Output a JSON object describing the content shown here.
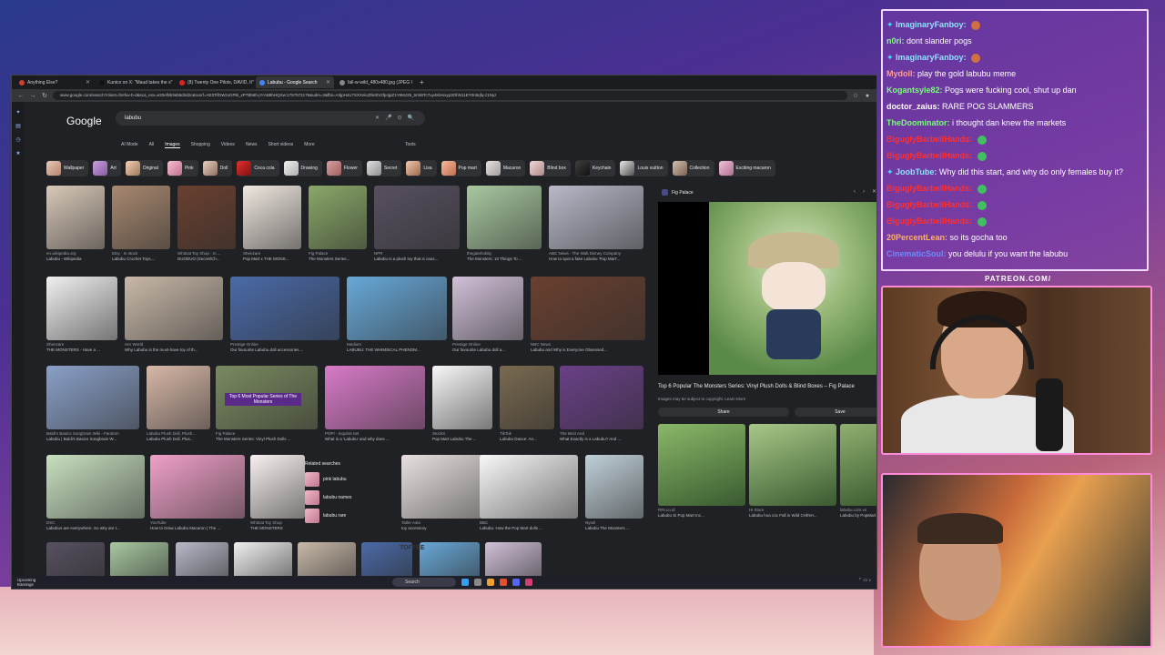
{
  "browser": {
    "tabs": [
      {
        "label": "Anything Else?",
        "color": "#d04030",
        "active": false
      },
      {
        "label": "Kunico on X: \"Maud takes the s\"",
        "color": "#111111",
        "active": false
      },
      {
        "label": "(8) Twenty One Pilots, DAVID, It\"",
        "color": "#e02020",
        "active": false
      },
      {
        "label": "Labubu - Google Search",
        "color": "#4285f4",
        "active": true
      },
      {
        "label": "fall-w-wild_480x480.jpg (JPEG I",
        "color": "#888888",
        "active": false
      }
    ],
    "url": "www.google.com/search?client=firefox-b-d&sca_esv=e20ef5b3eb6d2d2c&sxsrf=AE3TifOWzxGPl6_xP7Bb6h-jYrAB8hHQXw:1757572176&udm=2&fbs=AIIjpHxU7SXXniUZfeShr2fp4giZ1Y6MJ25_tmWITc7uy4Klesxyp3OhN11EY0n5qfq-z1Nyz",
    "search_query": "labubu",
    "filters": [
      "AI Mode",
      "All",
      "Images",
      "Shopping",
      "Videos",
      "News",
      "Short videos",
      "More"
    ],
    "active_filter": "Images",
    "tools_label": "Tools",
    "chips": [
      "Wallpaper",
      "Art",
      "Original",
      "Pink",
      "Doll",
      "Coca cola",
      "Drawing",
      "Flower",
      "Secret",
      "Lisa",
      "Pop mart",
      "Macaron",
      "Blind box",
      "Keychain",
      "Louis vuitton",
      "Collection",
      "Exciting macaron"
    ],
    "results": [
      {
        "source": "en.wikipedia.org",
        "title": "Labubu - Wikipedia"
      },
      {
        "source": "Etsy · In stock",
        "title": "Labubu Crochet Toys,..."
      },
      {
        "source": "Whitcat Toy Shop · In ...",
        "title": "DUODUO (Secret/Ch..."
      },
      {
        "source": "Shenzare",
        "title": "Pop Mart x THE MONS..."
      },
      {
        "source": "Fig Palace",
        "title": "The Monsters Series..."
      },
      {
        "source": "NPR",
        "title": "Labubu is a plush toy that is caus..."
      },
      {
        "source": "thegatehobby",
        "title": "The Monsters: 10 Things To ..."
      },
      {
        "source": "ABC News - The Walt Disney Company",
        "title": "How to spot a fake Labubu 'Pop Mart'..."
      },
      {
        "source": "Shenzare",
        "title": "THE MONSTERS - Have a ..."
      },
      {
        "source": "Her World",
        "title": "Why Labubu is the must-have toy of th..."
      },
      {
        "source": "Prestige Online",
        "title": "Our favourite Labubu doll accessories ..."
      },
      {
        "source": "Medium",
        "title": "LABUBU: THE WHIMSICAL PHENOM..."
      },
      {
        "source": "Prestige Online",
        "title": "Our favourite Labubu doll a..."
      },
      {
        "source": "NBC News",
        "title": "Labubu and Why is Everyone Obsessed..."
      },
      {
        "source": "Baldi's Basics Songbrain Wiki - Fandom",
        "title": "Labubu | Baldi's Basics Songbrain W..."
      },
      {
        "source": "Labubu Plush Doll, Plush...",
        "title": "Labubu Plush Doll, Plus..."
      },
      {
        "source": "Fig Palace",
        "title": "The Monsters Series: Vinyl Plush Dolls ..."
      },
      {
        "source": "POP! - Inquirer.net",
        "title": "What is a 'Labubu' and why does ..."
      },
      {
        "source": "StockX",
        "title": "Pop Mart Labubu The ..."
      },
      {
        "source": "TikTok",
        "title": "Labubu Dance: An..."
      },
      {
        "source": "The Best And",
        "title": "What Exactly is a Labubu? And ..."
      },
      {
        "source": "DSC",
        "title": "Labubus are everywhere. So why are t..."
      },
      {
        "source": "YouTube",
        "title": "How to Draw Labubu Macaron | The ..."
      },
      {
        "source": "Whitcat Toy Shop",
        "title": "THE MONSTERS"
      },
      {
        "source": "Tatler Asia",
        "title": "toy accessory"
      },
      {
        "source": "BBC",
        "title": "Labubu: How the Pop Mart dolls ..."
      },
      {
        "source": "Nysel",
        "title": "Labubu The Monsters ..."
      }
    ],
    "overlay_text": "Top 6 Most Popular Series of The Monsters",
    "toffee_label": "TOFFEE",
    "related": {
      "heading": "Related searches",
      "items": [
        "pink labubu",
        "labubu names",
        "labubu rare"
      ]
    },
    "preview": {
      "site": "Fig Palace",
      "title": "Top 6 Popular The Monsters Series: Vinyl Plush Dolls & Blind Boxes – Fig Palace",
      "subtitle": "Images may be subject to copyright. Learn More",
      "share_label": "Share",
      "save_label": "Save",
      "more": [
        {
          "source": "RRI.co.id",
          "title": "Labubu Si Pop Mart Inc..."
        },
        {
          "source": "Hi Store",
          "title": "Labubu hoa cúc Fall in Wild CHÍNH..."
        },
        {
          "source": "labubu.com.vn",
          "title": "Labubu by PopMart tu..."
        }
      ]
    },
    "taskbar": {
      "left_line1": "Upcoming",
      "left_line2": "Earnings",
      "search": "Search"
    }
  },
  "chat": {
    "messages": [
      {
        "user": "ImaginaryFanboy:",
        "text": "",
        "color": "#8fe3ff",
        "badge": true,
        "emote": true
      },
      {
        "user": "n0ri:",
        "text": "dont slander pogs",
        "color": "#80ff80",
        "badge": false,
        "emote": false
      },
      {
        "user": "ImaginaryFanboy:",
        "text": "",
        "color": "#8fe3ff",
        "badge": true,
        "emote": true
      },
      {
        "user": "Mydoll:",
        "text": "play the gold labubu meme",
        "color": "#ff9d9d",
        "badge": false,
        "emote": false
      },
      {
        "user": "Kogantsyle82:",
        "text": "Pogs were fucking cool, shut up dan",
        "color": "#7cfc7c",
        "badge": false,
        "emote": false
      },
      {
        "user": "doctor_zaius:",
        "text": "RARE POG SLAMMERS",
        "color": "#ffffff",
        "badge": false,
        "emote": false
      },
      {
        "user": "TheDoominator:",
        "text": "i thought dan knew the markets",
        "color": "#7cfc7c",
        "badge": false,
        "emote": false
      },
      {
        "user": "BiguglyBarbellHands:",
        "text": "",
        "color": "#ff3030",
        "badge": false,
        "emote": true
      },
      {
        "user": "BiguglyBarbellHands:",
        "text": "",
        "color": "#ff3030",
        "badge": false,
        "emote": true
      },
      {
        "user": "JoobTube:",
        "text": "Why did this start, and why do only females buy it?",
        "color": "#8fe3ff",
        "badge": true,
        "emote": false
      },
      {
        "user": "BiguglyBarbellHands:",
        "text": "",
        "color": "#ff3030",
        "badge": false,
        "emote": true
      },
      {
        "user": "BiguglyBarbellHands:",
        "text": "",
        "color": "#ff3030",
        "badge": false,
        "emote": true
      },
      {
        "user": "BiguglyBarbellHands:",
        "text": "",
        "color": "#ff3030",
        "badge": false,
        "emote": true
      },
      {
        "user": "20PercentLean:",
        "text": "so its gocha too",
        "color": "#ffb060",
        "badge": false,
        "emote": false
      },
      {
        "user": "CinematicSoul:",
        "text": "you delulu if you want the labubu",
        "color": "#6a8cff",
        "badge": false,
        "emote": false
      }
    ],
    "patreon": "PATREON.COM/",
    "brand_script": "Anything Else?"
  },
  "colors": {
    "chat_border": "#f0d8ff",
    "cam_border": "#ff8ad8",
    "google_dark": "#202124"
  }
}
